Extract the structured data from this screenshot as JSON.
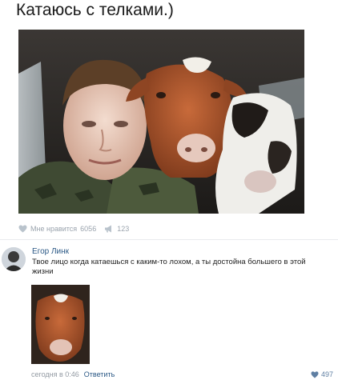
{
  "post": {
    "title": "Катаюсь с телками.)"
  },
  "actions": {
    "likes_label": "Мне нравится",
    "likes_count": "6056",
    "reposts_count": "123"
  },
  "comment": {
    "author": "Егор Линк",
    "text": "Твое лицо когда катаешься с каким-то лохом, а ты достойна большего в этой жизни",
    "time": "сегодня в 0:46",
    "reply_label": "Ответить",
    "likes": "497"
  },
  "colors": {
    "link": "#2a5885",
    "muted": "#9aa3ad",
    "like_heart": "#5f7fa3"
  },
  "icons": {
    "like": "heart-icon",
    "repost": "megaphone-icon"
  }
}
